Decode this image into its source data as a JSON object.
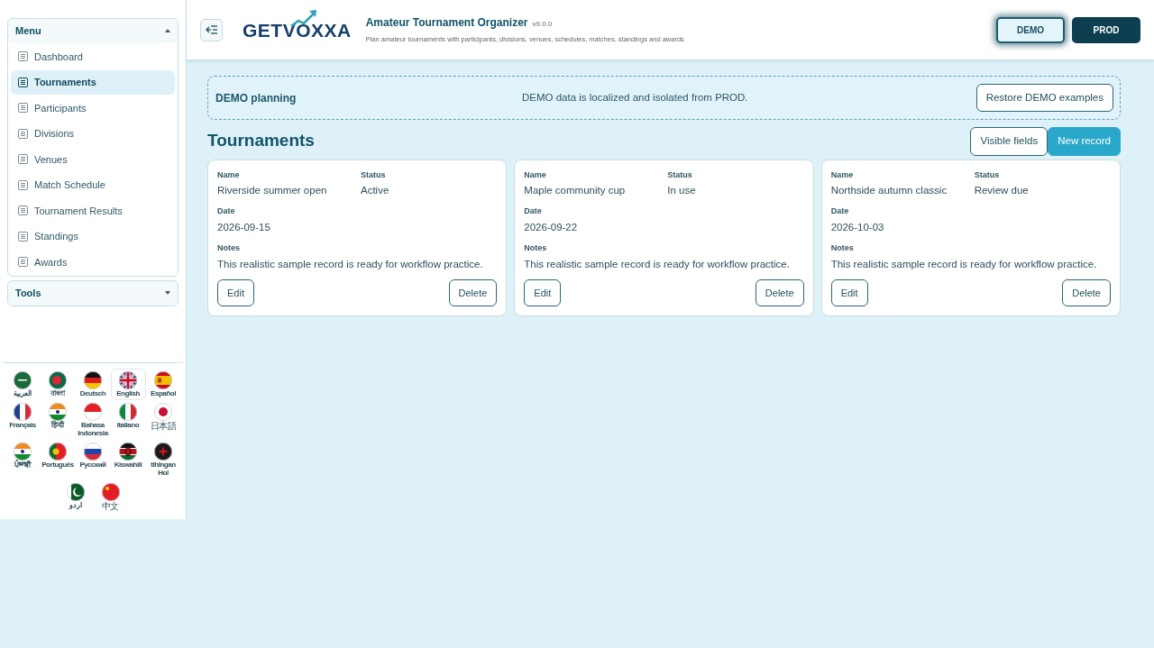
{
  "sidebar": {
    "menu": {
      "title": "Menu",
      "expanded": true,
      "items": [
        {
          "label": "Dashboard",
          "selected": false
        },
        {
          "label": "Tournaments",
          "selected": true
        },
        {
          "label": "Participants",
          "selected": false
        },
        {
          "label": "Divisions",
          "selected": false
        },
        {
          "label": "Venues",
          "selected": false
        },
        {
          "label": "Match Schedule",
          "selected": false
        },
        {
          "label": "Tournament Results",
          "selected": false
        },
        {
          "label": "Standings",
          "selected": false
        },
        {
          "label": "Awards",
          "selected": false
        }
      ]
    },
    "tools": {
      "title": "Tools",
      "expanded": false
    },
    "languages": [
      {
        "label": "العربية",
        "selected": false
      },
      {
        "label": "বাংলা",
        "selected": false
      },
      {
        "label": "Deutsch",
        "selected": false
      },
      {
        "label": "English",
        "selected": true
      },
      {
        "label": "Español",
        "selected": false
      },
      {
        "label": "Français",
        "selected": false
      },
      {
        "label": "हिन्दी",
        "selected": false
      },
      {
        "label": "Bahasa Indonesia",
        "selected": false
      },
      {
        "label": "Italiano",
        "selected": false
      },
      {
        "label": "日本語",
        "selected": false
      },
      {
        "label": "ਪੰਜਾਬੀ",
        "selected": false
      },
      {
        "label": "Português",
        "selected": false
      },
      {
        "label": "Русский",
        "selected": false
      },
      {
        "label": "Kiswahili",
        "selected": false
      },
      {
        "label": "tlhIngan Hol",
        "selected": false
      },
      {
        "label": "اردو",
        "selected": false
      },
      {
        "label": "中文",
        "selected": false
      }
    ]
  },
  "header": {
    "logo": "GETVOXXA",
    "title": "Amateur Tournament Organizer",
    "version": "v9.0.0",
    "subtitle": "Plan amateur tournaments with participants, divisions, venues, schedules, matches, standings and awards",
    "environments": [
      {
        "label": "DEMO",
        "selected": true
      },
      {
        "label": "PROD",
        "selected": false
      }
    ]
  },
  "banner": {
    "title": "DEMO planning",
    "message": "DEMO data is localized and isolated from PROD.",
    "button": "Restore DEMO examples"
  },
  "page": {
    "title": "Tournaments",
    "buttons": [
      "Visible fields",
      "New record"
    ]
  },
  "cards": [
    {
      "fields": [
        {
          "label": "Name",
          "value": "Riverside summer open"
        },
        {
          "label": "Status",
          "value": "Active"
        },
        {
          "label": "Date",
          "value": "2026-09-15"
        },
        {
          "label": "Notes",
          "value": "This realistic sample record is ready for workflow practice."
        }
      ],
      "buttons": [
        "Edit",
        "Delete"
      ]
    },
    {
      "fields": [
        {
          "label": "Name",
          "value": "Maple community cup"
        },
        {
          "label": "Status",
          "value": "In use"
        },
        {
          "label": "Date",
          "value": "2026-09-22"
        },
        {
          "label": "Notes",
          "value": "This realistic sample record is ready for workflow practice."
        }
      ],
      "buttons": [
        "Edit",
        "Delete"
      ]
    },
    {
      "fields": [
        {
          "label": "Name",
          "value": "Northside autumn classic"
        },
        {
          "label": "Status",
          "value": "Review due"
        },
        {
          "label": "Date",
          "value": "2026-10-03"
        },
        {
          "label": "Notes",
          "value": "This realistic sample record is ready for workflow practice."
        }
      ],
      "buttons": [
        "Edit",
        "Delete"
      ]
    }
  ]
}
